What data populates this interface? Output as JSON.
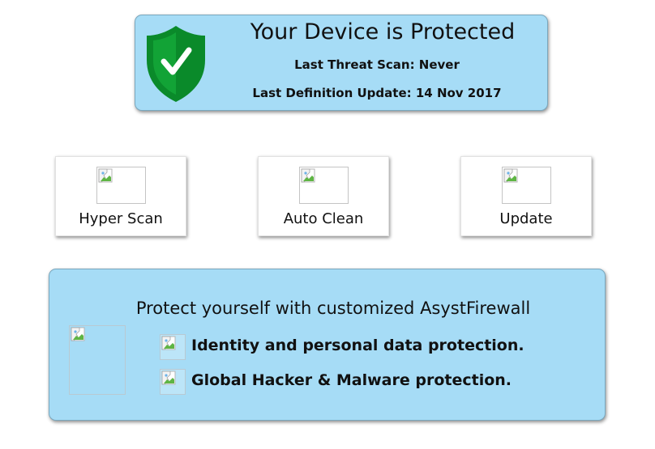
{
  "status": {
    "title": "Your Device is Protected",
    "last_scan": "Last Threat Scan: Never",
    "last_update": "Last Definition Update: 14 Nov 2017",
    "shield_icon": "shield-check-icon",
    "shield_color": "#0a8a2a"
  },
  "tools": [
    {
      "label": "Hyper Scan",
      "icon": "broken-image-icon"
    },
    {
      "label": "Auto Clean",
      "icon": "broken-image-icon"
    },
    {
      "label": "Update",
      "icon": "broken-image-icon"
    }
  ],
  "promo": {
    "title": "Protect yourself with customized AsystFirewall",
    "features": [
      {
        "text": "Identity and personal data protection.",
        "icon": "broken-image-icon"
      },
      {
        "text": "Global Hacker & Malware protection.",
        "icon": "broken-image-icon"
      }
    ]
  },
  "colors": {
    "panel_bg": "#a6dcf6",
    "panel_border": "#7aa7bd",
    "text": "#111111"
  }
}
